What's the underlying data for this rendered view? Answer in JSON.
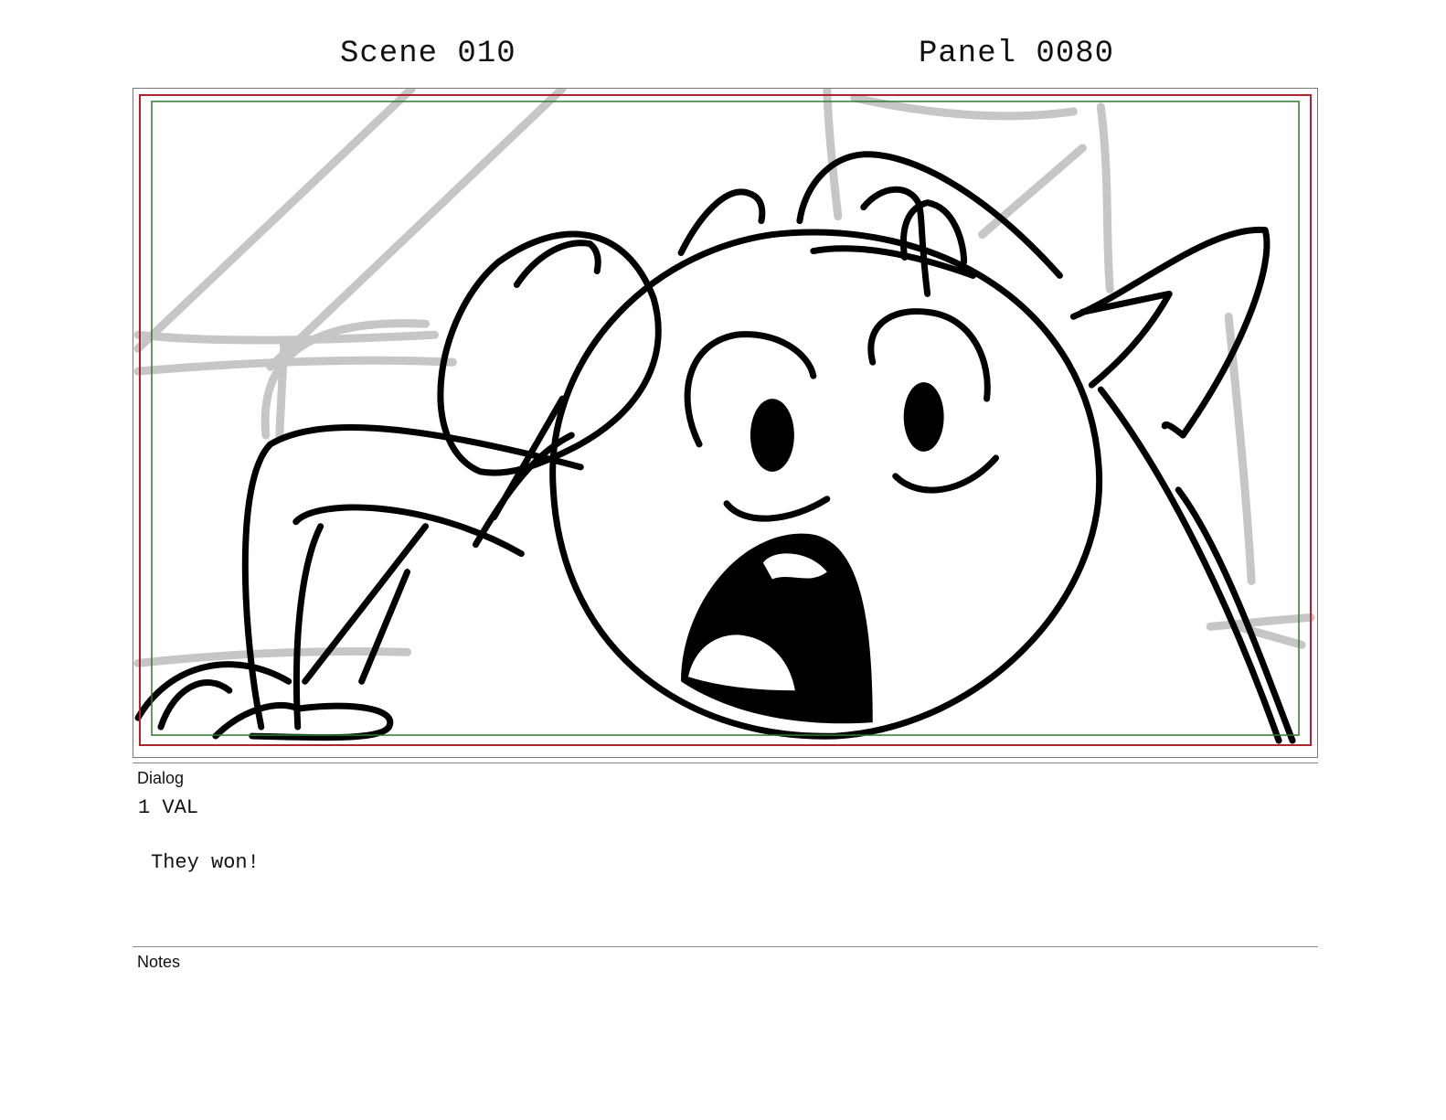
{
  "header": {
    "scene": "Scene 010",
    "panel": "Panel 0080"
  },
  "dialog": {
    "label": "Dialog",
    "speaker": "1 VAL",
    "line": "They won!"
  },
  "notes": {
    "label": "Notes",
    "text": ""
  },
  "colors": {
    "safe_red": "#b0202a",
    "safe_green": "#2f7a2f",
    "sketch_gray": "#c6c6c6",
    "ink": "#000000"
  }
}
